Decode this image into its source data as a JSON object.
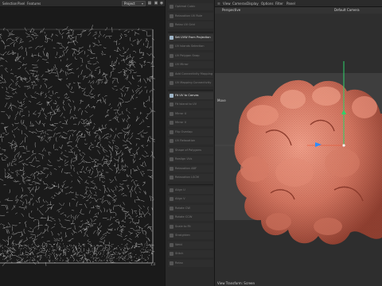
{
  "uv_editor": {
    "menu": [
      "Selection",
      "Pixel",
      "Features"
    ],
    "project_dropdown": "Project",
    "icons": [
      "grid-icon",
      "lock-icon",
      "eye-icon"
    ],
    "corner_label": "1,0"
  },
  "tools": [
    {
      "label": "Optimal Cubic",
      "active": false
    },
    {
      "label": "Relaxation UV Rule",
      "active": false
    },
    {
      "label": "Relax UV Grid",
      "active": false
    },
    {
      "label": "Set UVW From Projection",
      "active": true
    },
    {
      "label": "UV Islands Selection",
      "active": false
    },
    {
      "label": "UV Polygon Snap",
      "active": false
    },
    {
      "label": "UV Mirror",
      "active": false
    },
    {
      "label": "Add Connectivity Mapping",
      "active": false
    },
    {
      "label": "UV Mapping Connectivity",
      "active": false
    },
    {
      "label": "Fit UV to Canvas",
      "active": true
    },
    {
      "label": "Fit Island to UV",
      "active": false
    },
    {
      "label": "Mirror U",
      "active": false
    },
    {
      "label": "Mirror V",
      "active": false
    },
    {
      "label": "Flip Overlap",
      "active": false
    },
    {
      "label": "UV Relaxation",
      "active": false
    },
    {
      "label": "Shape of Polygons",
      "active": false
    },
    {
      "label": "Realign UVs",
      "active": false
    },
    {
      "label": "Relaxation ABF",
      "active": false
    },
    {
      "label": "Relaxation LSCM",
      "active": false
    },
    {
      "label": "Align U",
      "active": false
    },
    {
      "label": "Align V",
      "active": false
    },
    {
      "label": "Rotate CW",
      "active": false
    },
    {
      "label": "Rotate CCW",
      "active": false
    },
    {
      "label": "Scale to Fit",
      "active": false
    },
    {
      "label": "Straighten",
      "active": false
    },
    {
      "label": "Weld",
      "active": false
    },
    {
      "label": "Stitch",
      "active": false
    },
    {
      "label": "Relax",
      "active": false
    }
  ],
  "viewport": {
    "menu": [
      "View",
      "Cameras",
      "Display",
      "Options",
      "Filter",
      "Panel"
    ],
    "title": "Perspective",
    "camera": "Default Camera",
    "move_label": "Move",
    "status": "View Transform: Screen"
  },
  "colors": {
    "uv_bg": "#1b1b1b",
    "uv_lines": "#d9d9d9",
    "viewport_top": "#2f2f2f",
    "viewport_band": "#3d3d3d",
    "model_base": "#c96a55",
    "model_light": "#f0a08a",
    "axis_green": "#2fd36a",
    "axis_blue": "#2f8cff",
    "axis_red": "#e05a3a"
  }
}
